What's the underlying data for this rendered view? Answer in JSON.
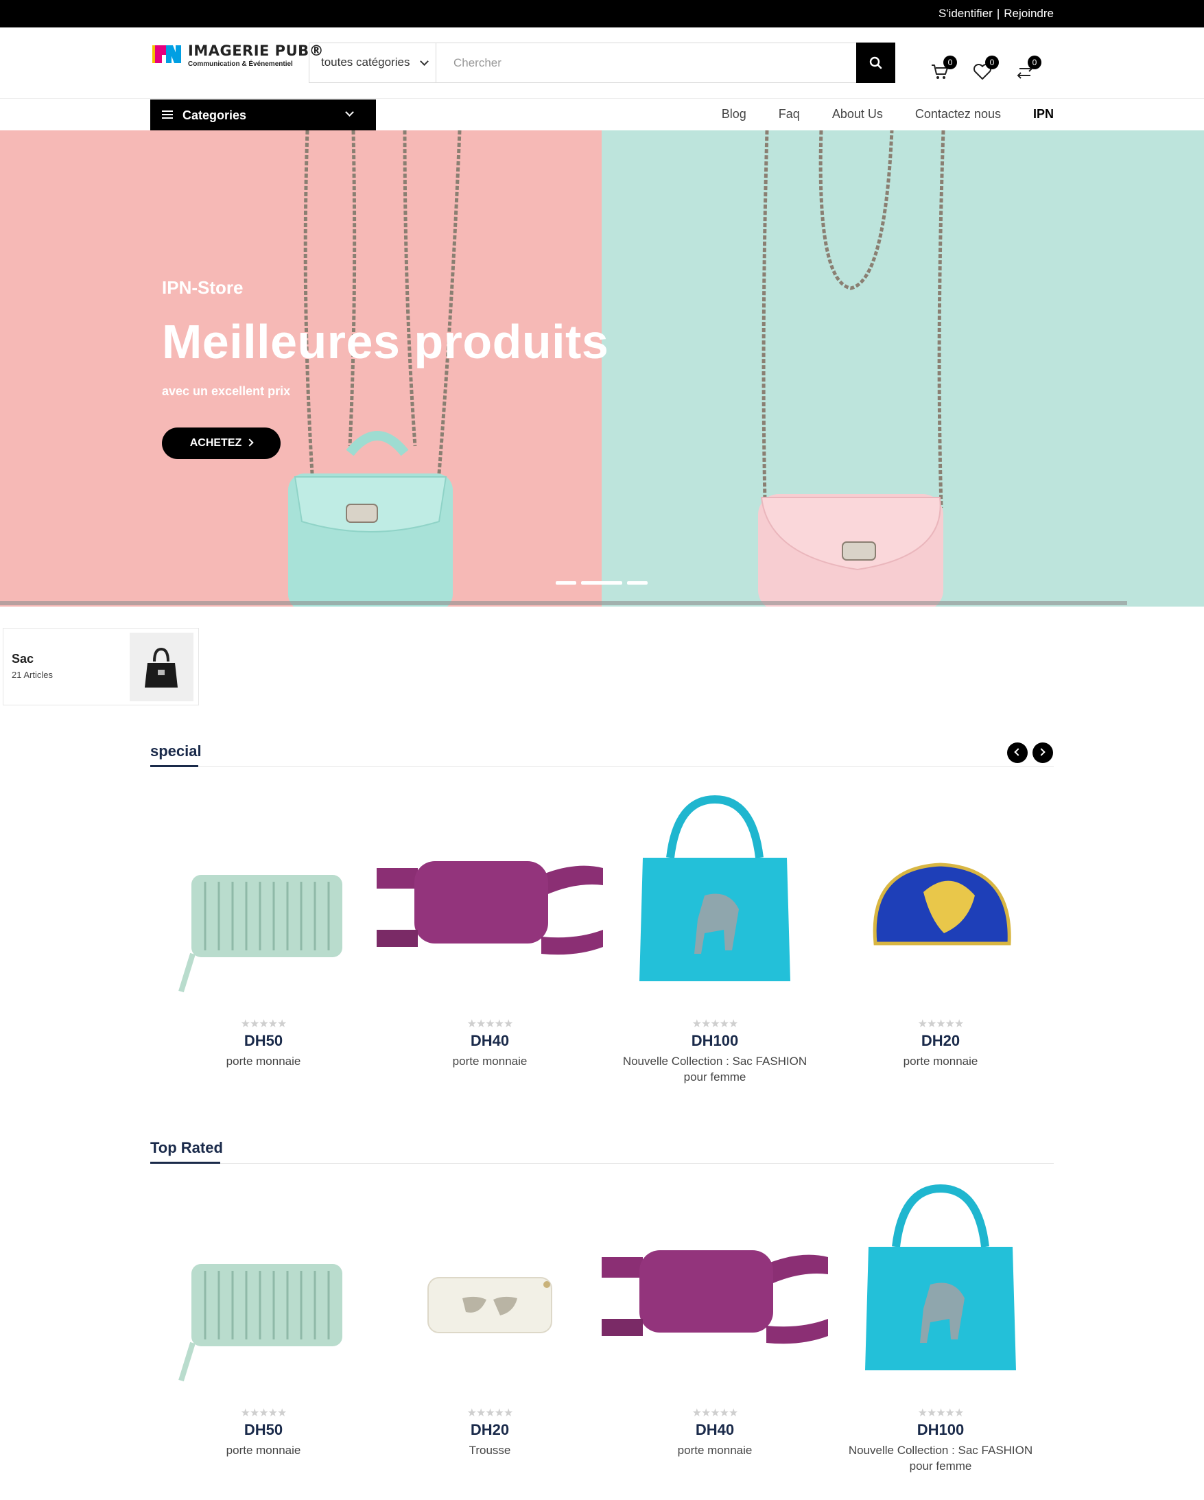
{
  "topbar": {
    "login": "S'identifier",
    "separator": "|",
    "register": "Rejoindre"
  },
  "header": {
    "logo": {
      "brand": "IMAGERIE PUB®",
      "tagline": "Communication & Événementiel",
      "mark_text": "IPN"
    },
    "search": {
      "category_value": "toutes catégories",
      "placeholder": "Chercher",
      "icon": "search-icon"
    },
    "icons": [
      {
        "name": "cart-icon",
        "count": "0"
      },
      {
        "name": "heart-icon",
        "count": "0"
      },
      {
        "name": "compare-icon",
        "count": "0"
      }
    ]
  },
  "nav": {
    "categories_label": "Categories",
    "links": [
      "Blog",
      "Faq",
      "About Us",
      "Contactez nous",
      "IPN"
    ]
  },
  "hero": {
    "eyebrow": "IPN-Store",
    "headline": "Meilleures produits",
    "subtitle": "avec un excellent prix",
    "cta": "ACHETEZ",
    "colors": {
      "left": "#f6b9b6",
      "right": "#bde4dc"
    }
  },
  "category_card": {
    "name": "Sac",
    "count": "21 Articles"
  },
  "sections": {
    "special": {
      "title": "special",
      "products": [
        {
          "price": "DH50",
          "title": "porte monnaie",
          "image": "mint-wallet"
        },
        {
          "price": "DH40",
          "title": "porte monnaie",
          "image": "purple-belt-bag"
        },
        {
          "price": "DH100",
          "title": "Nouvelle Collection : Sac FASHION pour femme",
          "image": "turquoise-unicorn-tote"
        },
        {
          "price": "DH20",
          "title": "porte monnaie",
          "image": "blue-leaf-pouch"
        }
      ]
    },
    "top_rated": {
      "title": "Top Rated",
      "products": [
        {
          "price": "DH50",
          "title": "porte monnaie",
          "image": "mint-wallet"
        },
        {
          "price": "DH20",
          "title": "Trousse",
          "image": "white-sunglasses-pouch"
        },
        {
          "price": "DH40",
          "title": "porte monnaie",
          "image": "purple-belt-bag"
        },
        {
          "price": "DH100",
          "title": "Nouvelle Collection : Sac FASHION pour femme",
          "image": "turquoise-unicorn-tote"
        }
      ]
    }
  },
  "rating_stars": "★★★★★"
}
